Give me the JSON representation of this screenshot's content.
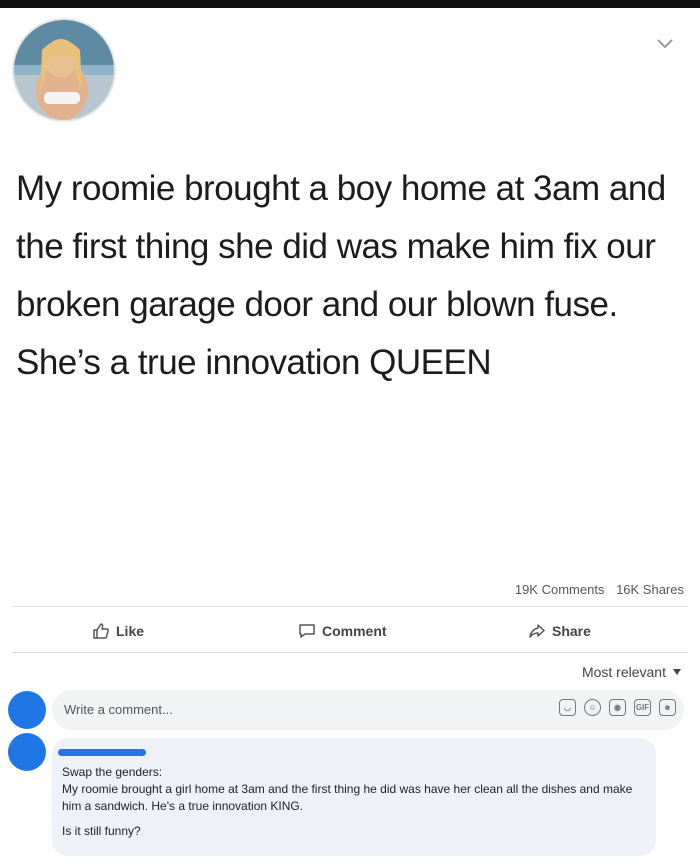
{
  "post": {
    "text": "My roomie brought a boy home at 3am and the first thing she did was make him fix our broken garage door and our blown fuse. She’s a true innovation QUEEN",
    "comments_count": "19K Comments",
    "shares_count": "16K Shares"
  },
  "actions": {
    "like": "Like",
    "comment": "Comment",
    "share": "Share"
  },
  "sort": {
    "label": "Most relevant"
  },
  "composer": {
    "placeholder": "Write a comment...",
    "icons": [
      "sticker-icon",
      "emoji-icon",
      "camera-icon",
      "gif-icon",
      "stickers-icon"
    ]
  },
  "reply": {
    "line1": "Swap the genders:",
    "line2": "My roomie brought a girl home at 3am and the first thing he did was have her clean all the dishes and make him a sandwich. He's a true innovation KING.",
    "line3": "Is it still funny?"
  },
  "colors": {
    "accent": "#1f77e6",
    "comment_bg": "#eef2f8",
    "input_bg": "#f2f3f5"
  }
}
